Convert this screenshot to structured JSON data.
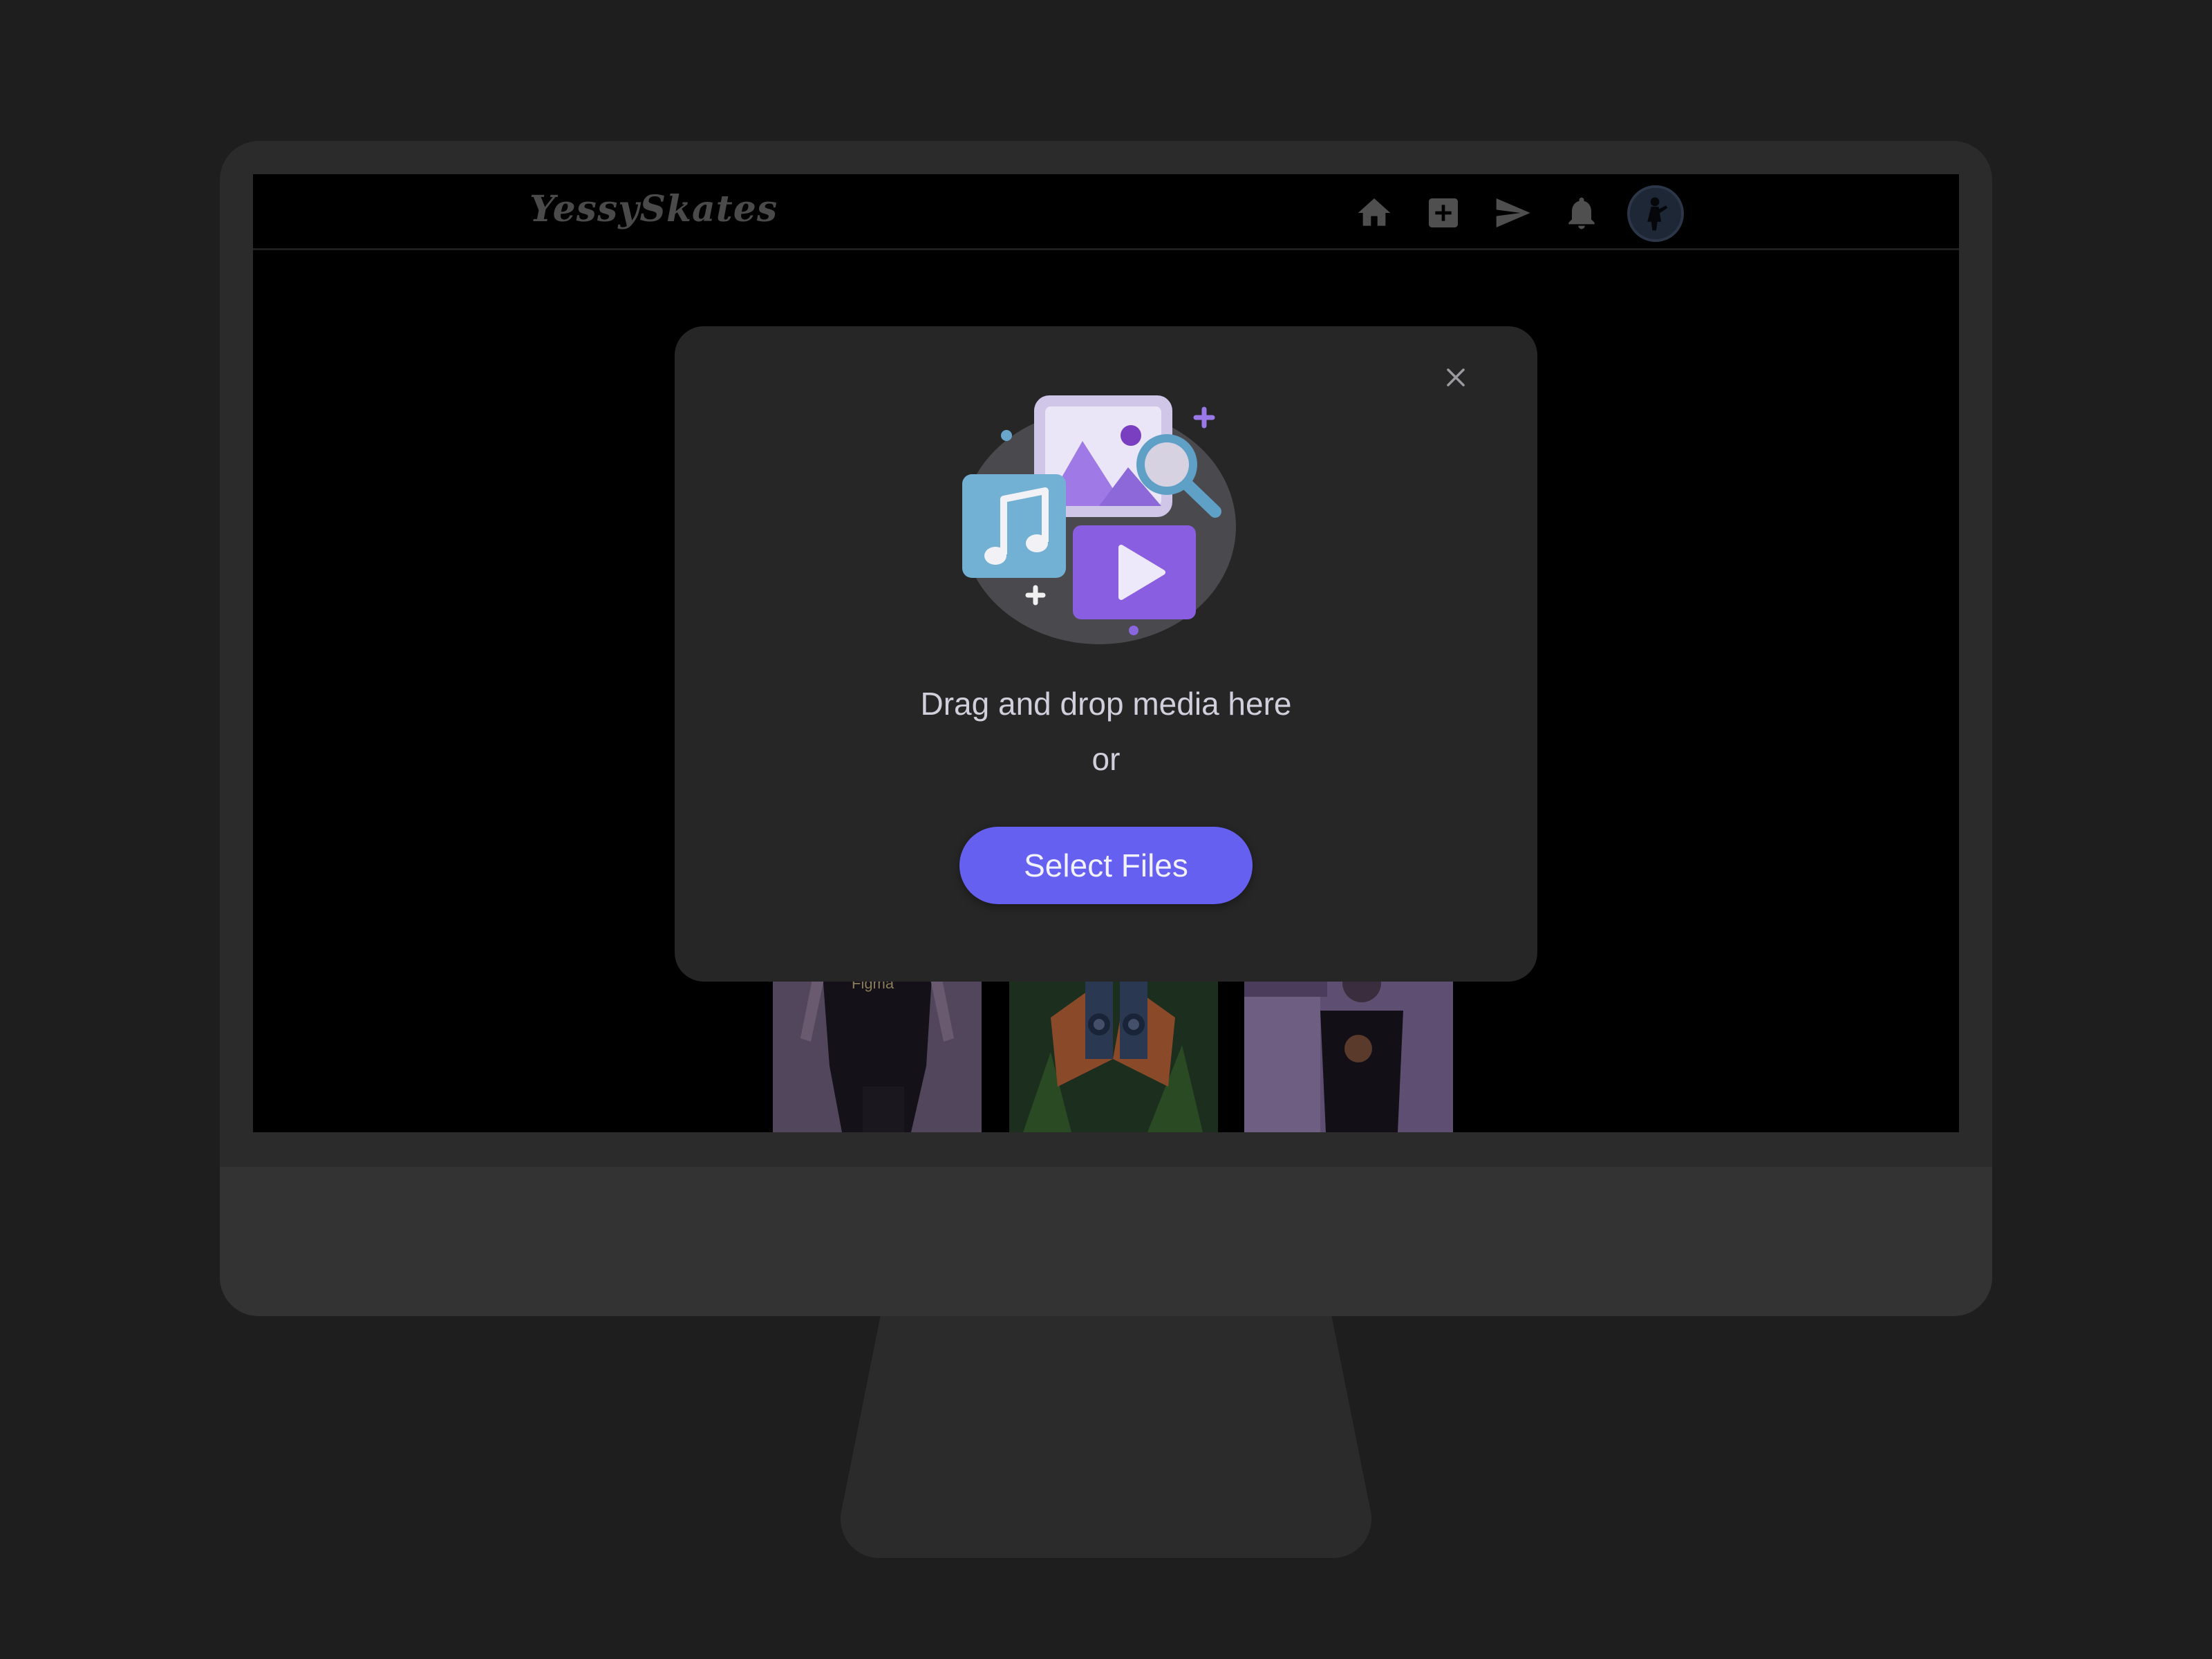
{
  "app": {
    "logo_text": "YessySkates"
  },
  "navbar": {
    "icons": [
      "home-icon",
      "add-post-icon",
      "send-icon",
      "notifications-icon"
    ],
    "icon_color": "#4f4f4f"
  },
  "modal": {
    "illustration": "media-upload-illustration",
    "prompt_text": "Drag and drop media here",
    "or_text": "or",
    "select_button_label": "Select Files",
    "close_icon": "close-icon",
    "accent_color": "#6560f0"
  },
  "thumbnails": [
    {
      "name": "post-thumbnail-1",
      "caption": "Figma"
    },
    {
      "name": "post-thumbnail-2",
      "caption": ""
    },
    {
      "name": "post-thumbnail-3",
      "caption": ""
    }
  ]
}
